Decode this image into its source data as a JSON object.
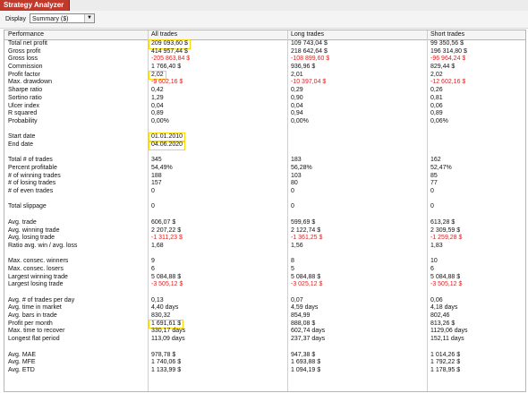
{
  "window": {
    "title": "Strategy Analyzer"
  },
  "toolbar": {
    "display_label": "Display",
    "display_value": "Summary ($)"
  },
  "headers": [
    "Performance",
    "All trades",
    "Long trades",
    "Short trades"
  ],
  "rows": [
    {
      "label": "Total net profit",
      "all": "209 093,60 $",
      "long": "109 743,04 $",
      "short": "99 350,56 $"
    },
    {
      "label": "Gross profit",
      "all": "414 957,44 $",
      "long": "218 642,64 $",
      "short": "196 314,80 $"
    },
    {
      "label": "Gross loss",
      "all": "-205 863,84 $",
      "long": "-108 899,60 $",
      "short": "-96 964,24 $"
    },
    {
      "label": "Commission",
      "all": "1 766,40 $",
      "long": "936,96 $",
      "short": "829,44 $"
    },
    {
      "label": "Profit factor",
      "all": "2,02",
      "long": "2,01",
      "short": "2,02"
    },
    {
      "label": "Max. drawdown",
      "all": "-9 602,16 $",
      "long": "-10 397,04 $",
      "short": "-12 602,16 $"
    },
    {
      "label": "Sharpe ratio",
      "all": "0,42",
      "long": "0,29",
      "short": "0,26"
    },
    {
      "label": "Sortino ratio",
      "all": "1,29",
      "long": "0,90",
      "short": "0,81"
    },
    {
      "label": "Ulcer index",
      "all": "0,04",
      "long": "0,04",
      "short": "0,06"
    },
    {
      "label": "R squared",
      "all": "0,89",
      "long": "0,94",
      "short": "0,89"
    },
    {
      "label": "Probability",
      "all": "0,00%",
      "long": "0,00%",
      "short": "0,06%"
    },
    {
      "label": "",
      "all": "",
      "long": "",
      "short": ""
    },
    {
      "label": "Start date",
      "all": "01.01.2010",
      "long": "",
      "short": ""
    },
    {
      "label": "End date",
      "all": "04.06.2020",
      "long": "",
      "short": ""
    },
    {
      "label": "",
      "all": "",
      "long": "",
      "short": ""
    },
    {
      "label": "Total # of trades",
      "all": "345",
      "long": "183",
      "short": "162"
    },
    {
      "label": "Percent profitable",
      "all": "54,49%",
      "long": "56,28%",
      "short": "52,47%"
    },
    {
      "label": "# of winning trades",
      "all": "188",
      "long": "103",
      "short": "85"
    },
    {
      "label": "# of losing trades",
      "all": "157",
      "long": "80",
      "short": "77"
    },
    {
      "label": "# of even trades",
      "all": "0",
      "long": "0",
      "short": "0"
    },
    {
      "label": "",
      "all": "",
      "long": "",
      "short": ""
    },
    {
      "label": "Total slippage",
      "all": "0",
      "long": "0",
      "short": "0"
    },
    {
      "label": "",
      "all": "",
      "long": "",
      "short": ""
    },
    {
      "label": "Avg. trade",
      "all": "606,07 $",
      "long": "599,69 $",
      "short": "613,28 $"
    },
    {
      "label": "Avg. winning trade",
      "all": "2 207,22 $",
      "long": "2 122,74 $",
      "short": "2 309,59 $"
    },
    {
      "label": "Avg. losing trade",
      "all": "-1 311,23 $",
      "long": "-1 361,25 $",
      "short": "-1 259,28 $"
    },
    {
      "label": "Ratio avg. win / avg. loss",
      "all": "1,68",
      "long": "1,56",
      "short": "1,83"
    },
    {
      "label": "",
      "all": "",
      "long": "",
      "short": ""
    },
    {
      "label": "Max. consec. winners",
      "all": "9",
      "long": "8",
      "short": "10"
    },
    {
      "label": "Max. consec. losers",
      "all": "6",
      "long": "5",
      "short": "6"
    },
    {
      "label": "Largest winning trade",
      "all": "5 084,88 $",
      "long": "5 084,88 $",
      "short": "5 084,88 $"
    },
    {
      "label": "Largest losing trade",
      "all": "-3 505,12 $",
      "long": "-3 025,12 $",
      "short": "-3 505,12 $"
    },
    {
      "label": "",
      "all": "",
      "long": "",
      "short": ""
    },
    {
      "label": "Avg. # of trades per day",
      "all": "0,13",
      "long": "0,07",
      "short": "0,06"
    },
    {
      "label": "Avg. time in market",
      "all": "4,40 days",
      "long": "4,59 days",
      "short": "4,18 days"
    },
    {
      "label": "Avg. bars in trade",
      "all": "830,32",
      "long": "854,99",
      "short": "802,46"
    },
    {
      "label": "Profit per month",
      "all": "1 691,61 $",
      "long": "888,08 $",
      "short": "813,26 $"
    },
    {
      "label": "Max. time to recover",
      "all": "330,17 days",
      "long": "602,74 days",
      "short": "1129,06 days"
    },
    {
      "label": "Longest flat period",
      "all": "113,09 days",
      "long": "237,37 days",
      "short": "152,11 days"
    },
    {
      "label": "",
      "all": "",
      "long": "",
      "short": ""
    },
    {
      "label": "Avg. MAE",
      "all": "978,78 $",
      "long": "947,38 $",
      "short": "1 014,26 $"
    },
    {
      "label": "Avg. MFE",
      "all": "1 740,06 $",
      "long": "1 693,88 $",
      "short": "1 792,22 $"
    },
    {
      "label": "Avg. ETD",
      "all": "1 133,99 $",
      "long": "1 094,19 $",
      "short": "1 178,95 $"
    }
  ],
  "highlighted_rows": [
    "Total net profit",
    "Profit factor",
    "Start date",
    "End date",
    "Profit per month"
  ],
  "colors": {
    "negative": "#e02020",
    "highlight": "#f5d90a",
    "title_tab": "#c0392b"
  }
}
